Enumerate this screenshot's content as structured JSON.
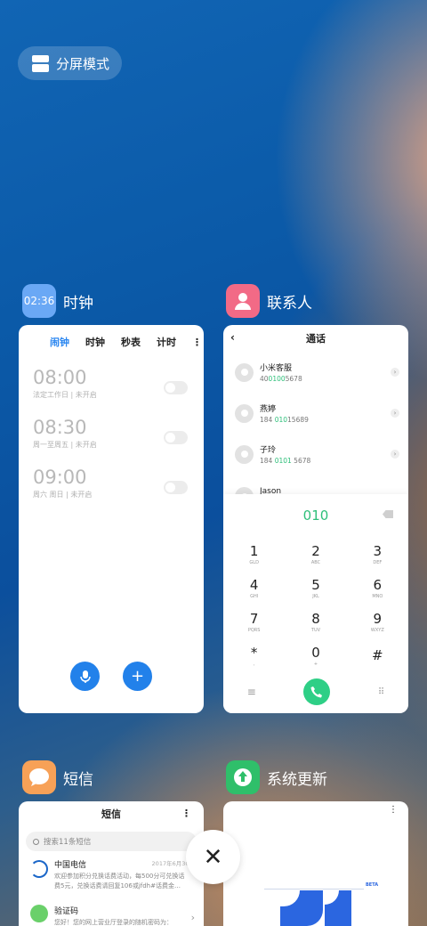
{
  "split_screen": {
    "label": "分屏模式"
  },
  "apps": {
    "clock": {
      "title": "时钟",
      "icon_text": "02:36",
      "icon_color": "#6aa8f5"
    },
    "contacts": {
      "title": "联系人",
      "icon_color": "#f26a86"
    },
    "sms": {
      "title": "短信",
      "icon_color": "#f7a157"
    },
    "update": {
      "title": "系统更新",
      "icon_color": "#2fbf6a"
    }
  },
  "clock": {
    "tabs": [
      "闹钟",
      "时钟",
      "秒表",
      "计时"
    ],
    "more": "⋮",
    "alarms": [
      {
        "time": "08:00",
        "repeat": "法定工作日 | 未开启"
      },
      {
        "time": "08:30",
        "repeat": "周一至周五 | 未开启"
      },
      {
        "time": "09:00",
        "repeat": "周六 周日 | 未开启"
      }
    ]
  },
  "contacts": {
    "title": "通话",
    "list": [
      {
        "name": "小米客服",
        "num_pre": "40",
        "num_hl": "0100",
        "num_post": "5678"
      },
      {
        "name": "燕婷",
        "num_pre": "184 ",
        "num_hl": "010",
        "num_post": "15689"
      },
      {
        "name": "子玲",
        "num_pre": "184 ",
        "num_hl": "0101",
        "num_post": " 5678"
      },
      {
        "name": "Jason",
        "num_pre": "",
        "num_hl": "",
        "num_post": ""
      }
    ],
    "dialed": "010",
    "keys": [
      {
        "d": "1",
        "l": "GLD"
      },
      {
        "d": "2",
        "l": "ABC"
      },
      {
        "d": "3",
        "l": "DEF"
      },
      {
        "d": "4",
        "l": "GHI"
      },
      {
        "d": "5",
        "l": "JKL"
      },
      {
        "d": "6",
        "l": "MNO"
      },
      {
        "d": "7",
        "l": "PQRS"
      },
      {
        "d": "8",
        "l": "TUV"
      },
      {
        "d": "9",
        "l": "WXYZ"
      },
      {
        "d": "*",
        "l": ","
      },
      {
        "d": "0",
        "l": "+"
      },
      {
        "d": "#",
        "l": ""
      }
    ]
  },
  "sms": {
    "title": "短信",
    "search_placeholder": "搜索11条短信",
    "messages": [
      {
        "name": "中国电信",
        "time": "2017年6月30日",
        "preview": "欢迎参加积分兑换话费活动，每500分可兑换话费5元，兑换话费请回复106或jfdh#话费金…"
      },
      {
        "name": "验证码",
        "time": "",
        "preview": "您好！您的网上营业厅登录的随机密码为："
      }
    ]
  },
  "update": {
    "badge": "BETA"
  },
  "close": {
    "label": "✕"
  }
}
